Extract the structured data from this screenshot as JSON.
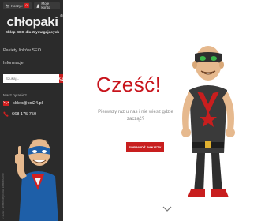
{
  "topbar": {
    "cart_label": "Koszyk",
    "cart_count": "0",
    "account_label": "Moje konto"
  },
  "logo": {
    "text": "chłopaki",
    "registered": "®",
    "subtitle": "Sklep SEO dla Wymagających"
  },
  "nav": {
    "items": [
      {
        "label": "Pakiety linków SEO"
      },
      {
        "label": "Informacje"
      }
    ]
  },
  "search": {
    "placeholder": "Szukaj..."
  },
  "contact": {
    "heading": "Masz pytanie?",
    "email": "sklep@coi24.pl",
    "phone": "668 175 750"
  },
  "sidebar_footer": "© 2020 - Wszelkie prawa zastrzeżone",
  "hero": {
    "greeting": "Cześć!",
    "question": "Pierwszy raz u nas i nie wiesz gdzie zacząć?",
    "cta_label": "SPRAWDŹ PAKIETY"
  },
  "colors": {
    "accent": "#c81e1e",
    "sidebar_bg": "#2b2b2b"
  },
  "icons": {
    "cart": "cart-icon",
    "account": "user-icon",
    "search": "search-icon",
    "email": "envelope-icon",
    "phone": "phone-icon",
    "scroll": "chevron-down-icon"
  }
}
